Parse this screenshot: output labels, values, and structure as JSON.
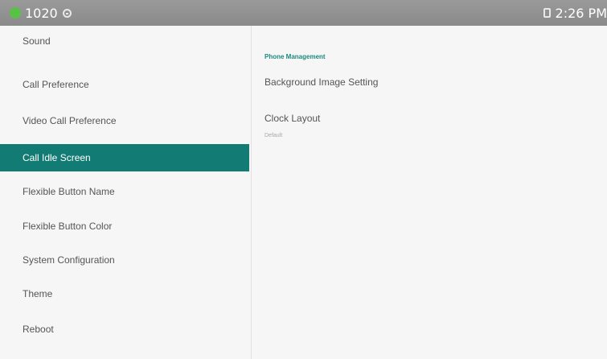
{
  "status_bar": {
    "extension": "1020",
    "time": "2:26 PM",
    "indicator_color": "#57c245",
    "icons": [
      "globe-icon",
      "phone-icon"
    ]
  },
  "sidebar": {
    "items": [
      {
        "label": "Sound"
      },
      {
        "label": "Call Preference"
      },
      {
        "label": "Video Call Preference"
      },
      {
        "label": "Call Idle Screen",
        "active": true
      },
      {
        "label": "Flexible Button Name"
      },
      {
        "label": "Flexible Button Color"
      },
      {
        "label": "System Configuration"
      },
      {
        "label": "Theme"
      },
      {
        "label": "Reboot"
      }
    ],
    "active_color": "#127b73"
  },
  "main": {
    "section_title": "Phone Management",
    "settings": [
      {
        "title": "Background Image Setting"
      },
      {
        "title": "Clock Layout",
        "subtitle": "Default"
      }
    ]
  }
}
